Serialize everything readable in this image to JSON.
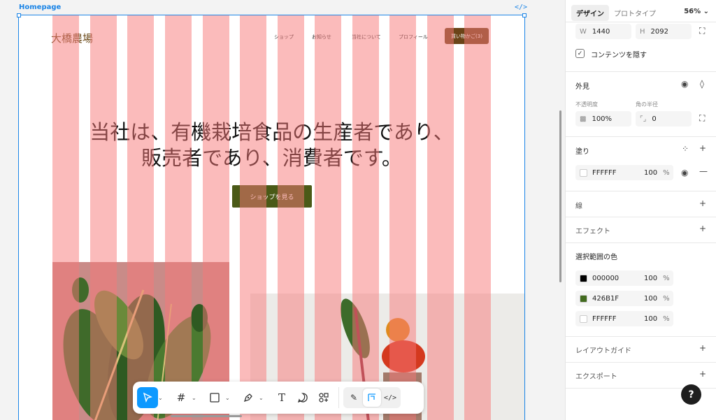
{
  "canvas": {
    "frame_label": "Homepage",
    "code_icon": "</>"
  },
  "site": {
    "logo": "大橋農場",
    "nav": [
      "ショップ",
      "お知らせ",
      "当社について",
      "プロフィール"
    ],
    "cart": "買い物かご(3)",
    "hero_line1": "当社は、有機栽培食品の生産者であり、",
    "hero_line2": "販売者であり、消費者です。",
    "shop_button": "ショップを見る"
  },
  "toolbar": {
    "tools": [
      "move-tool",
      "frame-tool",
      "shape-tool",
      "pen-tool",
      "text-tool",
      "comment-tool",
      "actions-tool"
    ],
    "modes": [
      "draw-mode",
      "design-mode",
      "dev-mode"
    ]
  },
  "panel": {
    "tab_design": "デザイン",
    "tab_prototype": "プロトタイプ",
    "zoom": "56%",
    "w_label": "W",
    "w_value": "1440",
    "h_label": "H",
    "h_value": "2092",
    "clip_content": "コンテンツを隠す",
    "appearance": "外見",
    "opacity_label": "不透明度",
    "radius_label": "角の半径",
    "opacity_value": "100%",
    "radius_value": "0",
    "fill": "塗り",
    "fill_hex": "FFFFFF",
    "fill_pct": "100",
    "pct_sign": "%",
    "stroke": "線",
    "effects": "エフェクト",
    "selection_colors": "選択範囲の色",
    "colors": [
      {
        "hex": "000000",
        "pct": "100",
        "swatch": "#000000"
      },
      {
        "hex": "426B1F",
        "pct": "100",
        "swatch": "#426B1F"
      },
      {
        "hex": "FFFFFF",
        "pct": "100",
        "swatch": "#FFFFFF"
      }
    ],
    "layout_guide": "レイアウトガイド",
    "export": "エクスポート",
    "help": "?"
  }
}
